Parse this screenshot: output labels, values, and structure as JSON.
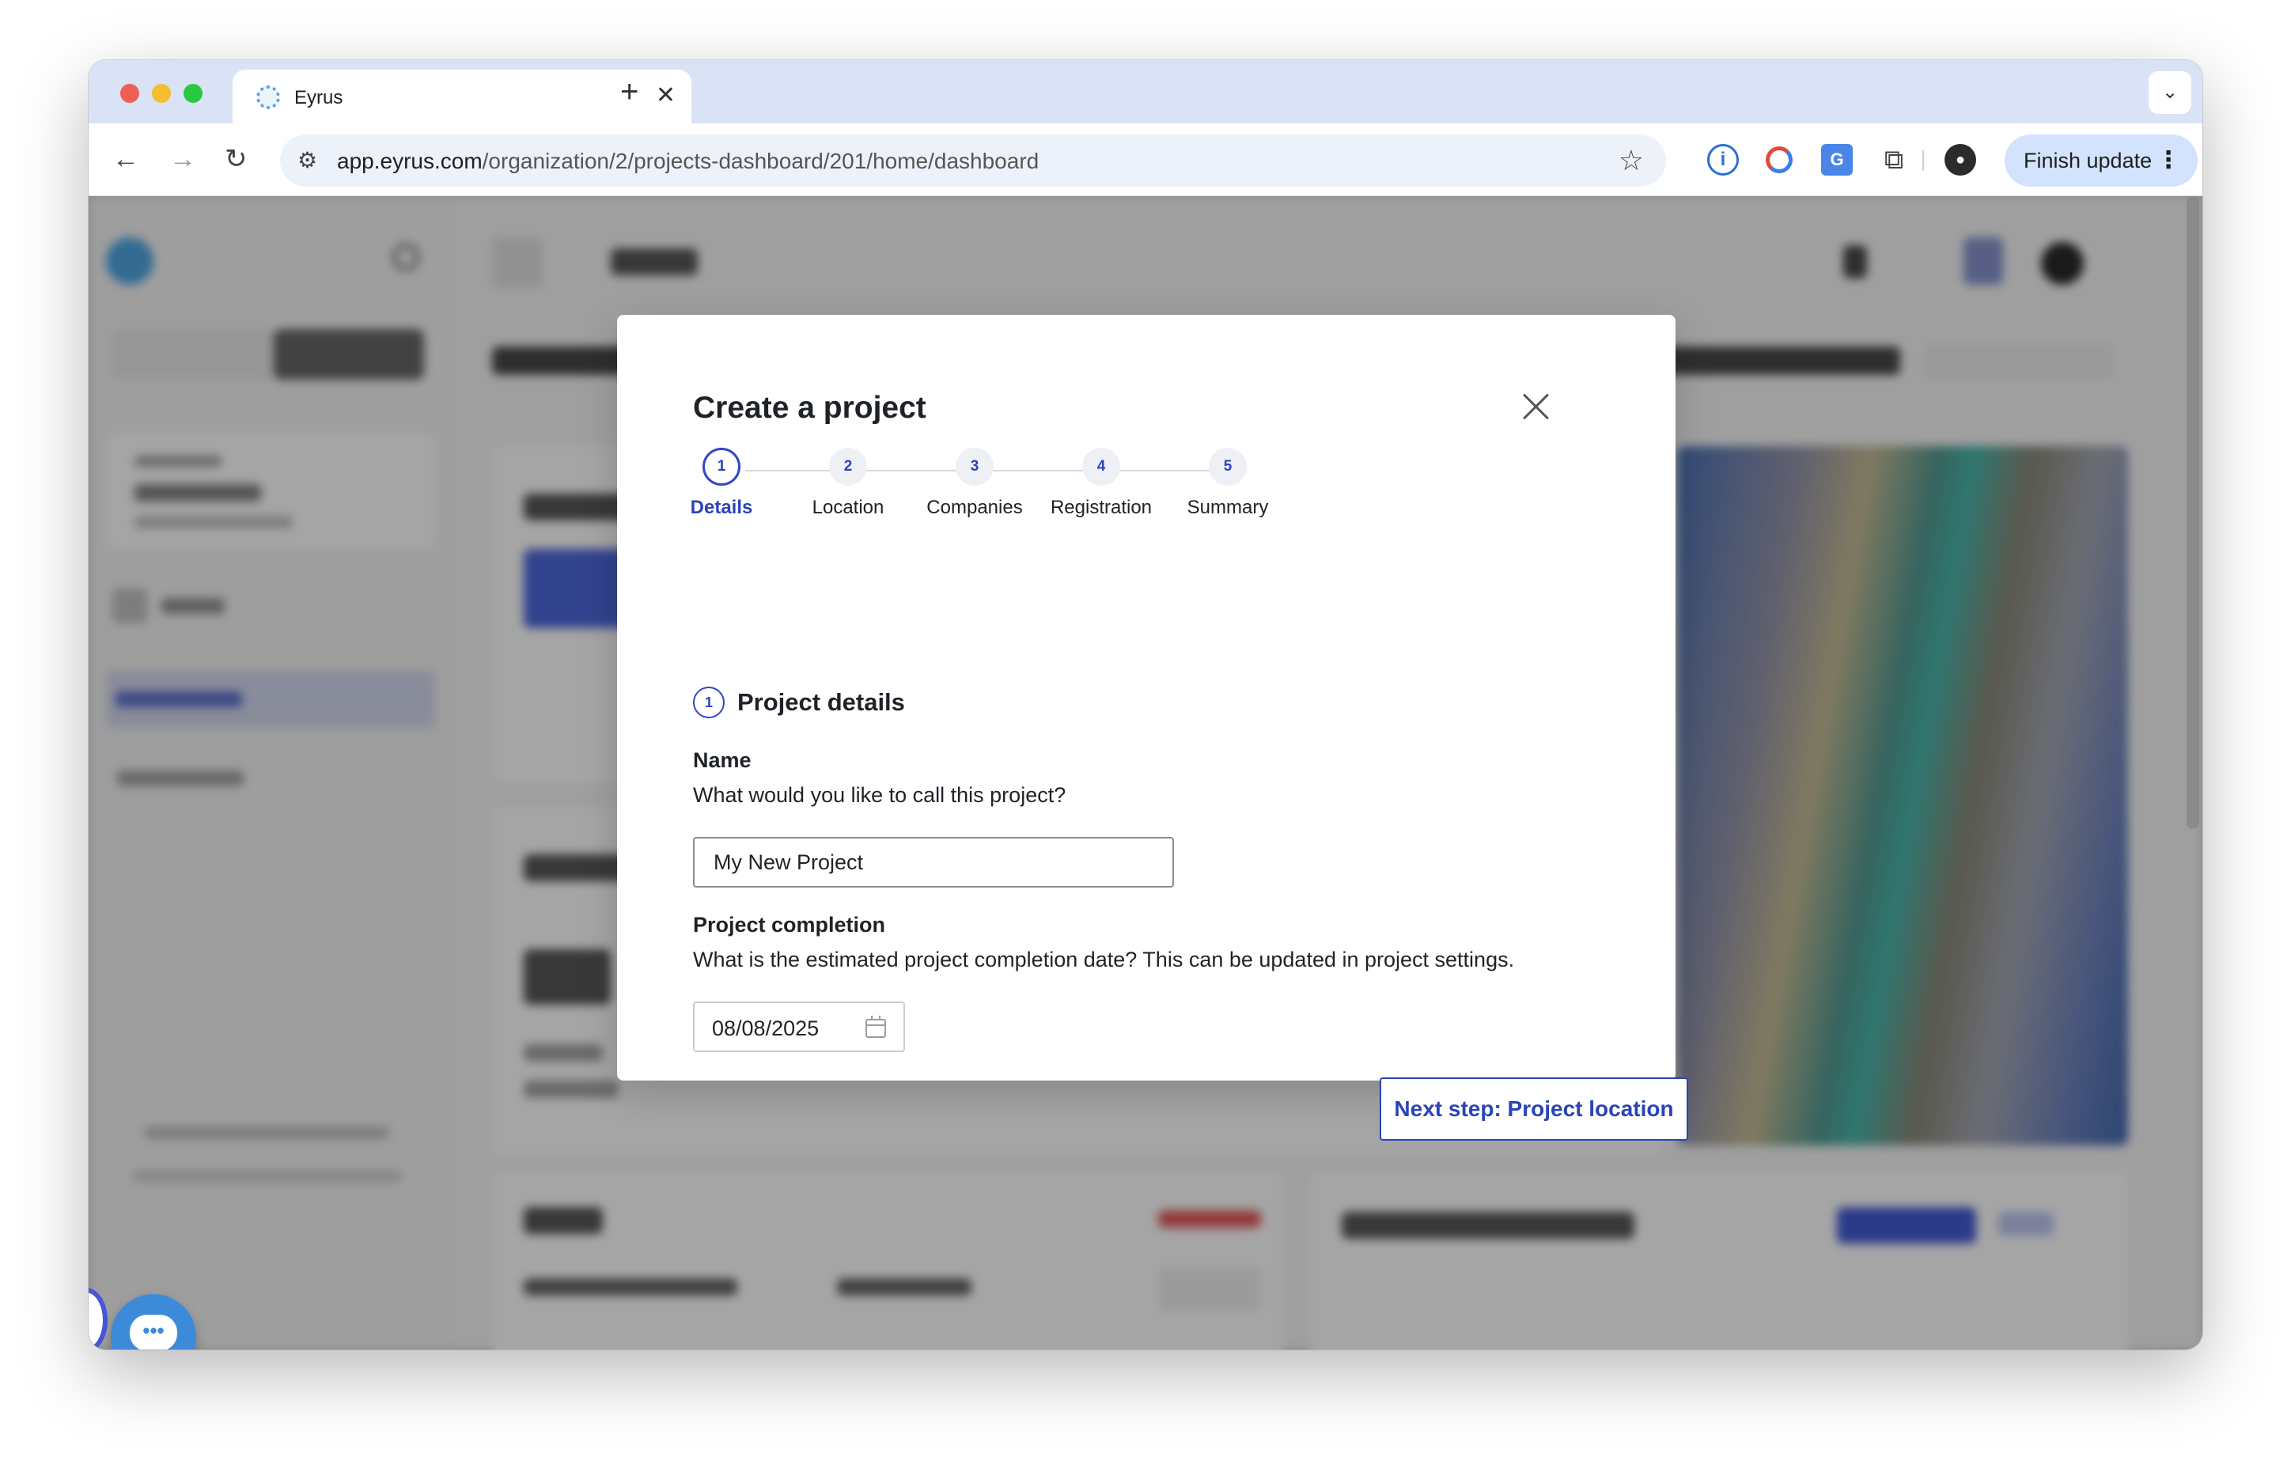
{
  "browser": {
    "tab_title": "Eyrus",
    "tab_close": "✕",
    "new_tab": "+",
    "url_host": "app.eyrus.com",
    "url_path": "/organization/2/projects-dashboard/201/home/dashboard",
    "finish_update_label": "Finish update"
  },
  "modal": {
    "title": "Create a project",
    "steps": [
      {
        "number": "1",
        "label": "Details",
        "active": true
      },
      {
        "number": "2",
        "label": "Location",
        "active": false
      },
      {
        "number": "3",
        "label": "Companies",
        "active": false
      },
      {
        "number": "4",
        "label": "Registration",
        "active": false
      },
      {
        "number": "5",
        "label": "Summary",
        "active": false
      }
    ],
    "section_number": "1",
    "section_title": "Project details",
    "name_label": "Name",
    "name_help": "What would you like to call this project?",
    "name_value": "My New Project",
    "completion_label": "Project completion",
    "completion_help": "What is the estimated project completion date? This can be updated in project settings.",
    "completion_value": "08/08/2025",
    "next_button_label": "Next step: Project location"
  },
  "chat_widget": {
    "icon": "chat-bubble-icon",
    "glyph": "•••"
  },
  "colors": {
    "accent": "#2a44b8",
    "tabstrip": "#d9e3f5",
    "chat": "#3d8bd8"
  }
}
